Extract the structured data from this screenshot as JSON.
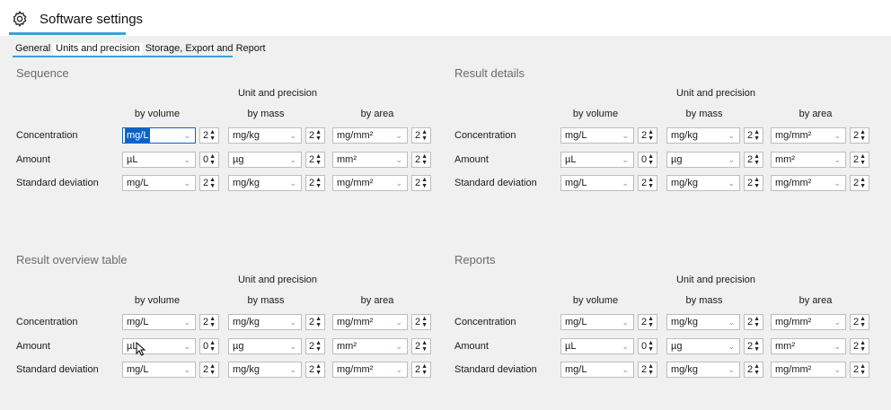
{
  "window": {
    "title": "Software settings",
    "icon": "gear-icon"
  },
  "tabs": [
    {
      "label": "General"
    },
    {
      "label": "Units and precision"
    },
    {
      "label": "Storage, Export and Report"
    }
  ],
  "sections": [
    {
      "title": "Sequence",
      "unit_precision": "Unit and precision",
      "columns": [
        "by volume",
        "by mass",
        "by area"
      ],
      "rows": [
        {
          "label": "Concentration",
          "volume": "mg/L",
          "vol_prec": "2",
          "mass": "mg/kg",
          "mass_prec": "2",
          "area": "mg/mm²",
          "area_prec": "2"
        },
        {
          "label": "Amount",
          "volume": "µL",
          "vol_prec": "0",
          "mass": "µg",
          "mass_prec": "2",
          "area": "mm²",
          "area_prec": "2"
        },
        {
          "label": "Standard deviation",
          "volume": "mg/L",
          "vol_prec": "2",
          "mass": "mg/kg",
          "mass_prec": "2",
          "area": "mg/mm²",
          "area_prec": "2"
        }
      ]
    },
    {
      "title": "Result details",
      "unit_precision": "Unit and precision",
      "columns": [
        "by volume",
        "by mass",
        "by area"
      ],
      "rows": [
        {
          "label": "Concentration",
          "volume": "mg/L",
          "vol_prec": "2",
          "mass": "mg/kg",
          "mass_prec": "2",
          "area": "mg/mm²",
          "area_prec": "2"
        },
        {
          "label": "Amount",
          "volume": "µL",
          "vol_prec": "0",
          "mass": "µg",
          "mass_prec": "2",
          "area": "mm²",
          "area_prec": "2"
        },
        {
          "label": "Standard deviation",
          "volume": "mg/L",
          "vol_prec": "2",
          "mass": "mg/kg",
          "mass_prec": "2",
          "area": "mg/mm²",
          "area_prec": "2"
        }
      ]
    },
    {
      "title": "Result overview table",
      "unit_precision": "Unit and precision",
      "columns": [
        "by volume",
        "by mass",
        "by area"
      ],
      "rows": [
        {
          "label": "Concentration",
          "volume": "mg/L",
          "vol_prec": "2",
          "mass": "mg/kg",
          "mass_prec": "2",
          "area": "mg/mm²",
          "area_prec": "2"
        },
        {
          "label": "Amount",
          "volume": "µL",
          "vol_prec": "0",
          "mass": "µg",
          "mass_prec": "2",
          "area": "mm²",
          "area_prec": "2"
        },
        {
          "label": "Standard deviation",
          "volume": "mg/L",
          "vol_prec": "2",
          "mass": "mg/kg",
          "mass_prec": "2",
          "area": "mg/mm²",
          "area_prec": "2"
        }
      ]
    },
    {
      "title": "Reports",
      "unit_precision": "Unit and precision",
      "columns": [
        "by volume",
        "by mass",
        "by area"
      ],
      "rows": [
        {
          "label": "Concentration",
          "volume": "mg/L",
          "vol_prec": "2",
          "mass": "mg/kg",
          "mass_prec": "2",
          "area": "mg/mm²",
          "area_prec": "2"
        },
        {
          "label": "Amount",
          "volume": "µL",
          "vol_prec": "0",
          "mass": "µg",
          "mass_prec": "2",
          "area": "mm²",
          "area_prec": "2"
        },
        {
          "label": "Standard deviation",
          "volume": "mg/L",
          "vol_prec": "2",
          "mass": "mg/kg",
          "mass_prec": "2",
          "area": "mg/mm²",
          "area_prec": "2"
        }
      ]
    }
  ],
  "colors": {
    "accent": "#3aa0d8",
    "selection": "#0a64c8",
    "section_title": "#6b6b6b"
  }
}
